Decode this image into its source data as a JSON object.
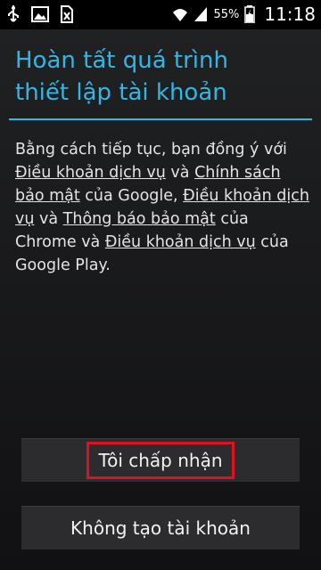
{
  "status_bar": {
    "battery_percent": "55%",
    "time": "11:18",
    "icons": [
      "usb-icon",
      "image-icon",
      "sim-missing-icon",
      "wifi-icon",
      "signal-icon",
      "battery-icon"
    ]
  },
  "page": {
    "title": "Hoàn tất quá trình thiết lập tài khoản",
    "intro": "Bằng cách tiếp tục, bạn đồng ý với",
    "link_tos": "Điều khoản dịch vụ",
    "and1": " và ",
    "link_privacy": "Chính sách bảo mật",
    "google_suffix": " của Google, ",
    "link_chrome_tos": "Điều khoản dịch vụ",
    "and2": " và ",
    "link_chrome_privacy": "Thông báo bảo mật",
    "chrome_suffix": "  của Chrome và ",
    "link_play_tos": "Điều khoản dịch vụ",
    "play_suffix": " của Google Play."
  },
  "buttons": {
    "accept": "Tôi chấp nhận",
    "decline": "Không tạo tài khoản"
  },
  "colors": {
    "accent": "#33b5e5",
    "highlight": "#e01020"
  }
}
